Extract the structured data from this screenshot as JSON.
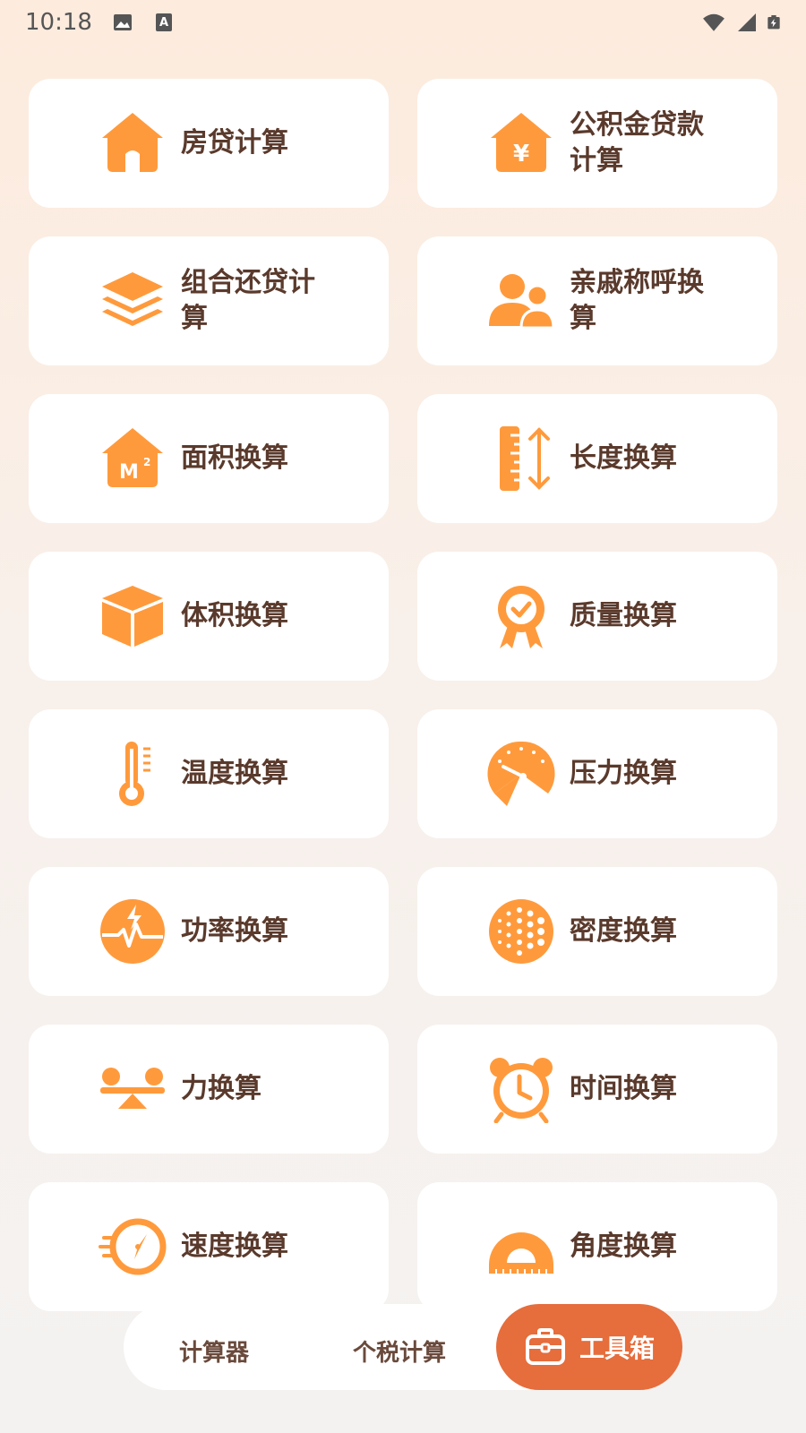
{
  "status_bar": {
    "time": "10:18",
    "icons": [
      "image-icon",
      "keyboard-a-icon",
      "wifi-icon",
      "signal-icon",
      "battery-charging-icon"
    ]
  },
  "accent_color": "#ff9a3c",
  "tools": [
    {
      "label": "房贷计算",
      "icon": "house-icon"
    },
    {
      "label": "公积金贷款计算",
      "icon": "house-yen-icon"
    },
    {
      "label": "组合还贷计算",
      "icon": "layers-icon"
    },
    {
      "label": "亲戚称呼换算",
      "icon": "people-icon"
    },
    {
      "label": "面积换算",
      "icon": "house-m2-icon"
    },
    {
      "label": "长度换算",
      "icon": "ruler-icon"
    },
    {
      "label": "体积换算",
      "icon": "cube-icon"
    },
    {
      "label": "质量换算",
      "icon": "badge-check-icon"
    },
    {
      "label": "温度换算",
      "icon": "thermometer-icon"
    },
    {
      "label": "压力换算",
      "icon": "gauge-icon"
    },
    {
      "label": "功率换算",
      "icon": "power-icon"
    },
    {
      "label": "密度换算",
      "icon": "dots-circle-icon"
    },
    {
      "label": "力换算",
      "icon": "balance-icon"
    },
    {
      "label": "时间换算",
      "icon": "alarm-clock-icon"
    },
    {
      "label": "速度换算",
      "icon": "compass-speed-icon"
    },
    {
      "label": "角度换算",
      "icon": "protractor-icon"
    }
  ],
  "bottom_nav": {
    "calculator": "计算器",
    "tax": "个税计算",
    "toolbox": "工具箱",
    "active": "工具箱"
  }
}
